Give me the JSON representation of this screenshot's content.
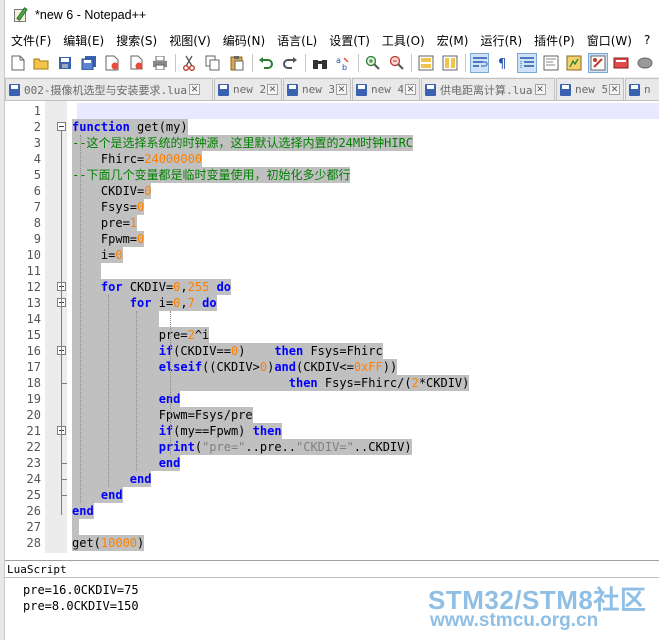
{
  "window": {
    "title": "*new 6 - Notepad++"
  },
  "menu": [
    "文件(F)",
    "编辑(E)",
    "搜索(S)",
    "视图(V)",
    "编码(N)",
    "语言(L)",
    "设置(T)",
    "工具(O)",
    "宏(M)",
    "运行(R)",
    "插件(P)",
    "窗口(W)",
    "?"
  ],
  "toolbar": {
    "buttons": [
      "new-file",
      "open-file",
      "save",
      "save-all",
      "close",
      "close-all",
      "print",
      "cut",
      "copy",
      "paste",
      "undo",
      "redo",
      "find",
      "replace",
      "zoom-in",
      "zoom-out",
      "sync-v",
      "sync-h",
      "word-wrap",
      "show-all-chars",
      "indent-guide",
      "user-define",
      "doc-map",
      "function-list",
      "folder-workspace",
      "record-macro"
    ]
  },
  "tabs": [
    {
      "label": "002-摄像机选型与安装要求.lua",
      "active": false
    },
    {
      "label": "new 2",
      "active": false
    },
    {
      "label": "new 3",
      "active": false
    },
    {
      "label": "new 4",
      "active": false
    },
    {
      "label": "供电距离计算.lua",
      "active": false
    },
    {
      "label": "new 5",
      "active": false
    },
    {
      "label": "n",
      "active": false
    }
  ],
  "editor": {
    "line_numbers": [
      "1",
      "2",
      "3",
      "4",
      "5",
      "6",
      "7",
      "8",
      "9",
      "10",
      "11",
      "12",
      "13",
      "14",
      "15",
      "16",
      "17",
      "18",
      "19",
      "20",
      "21",
      "22",
      "23",
      "24",
      "25",
      "26",
      "27",
      "28"
    ],
    "lines": [
      [],
      [
        {
          "t": "function",
          "c": "kw"
        },
        {
          "t": " get(my)",
          "c": "fn"
        }
      ],
      [
        {
          "t": "--这个是选择系统的时钟源，这里默认选择内置的24M时钟HIRC",
          "c": "cmt"
        }
      ],
      [
        {
          "t": "    Fhirc=",
          "c": "fn"
        },
        {
          "t": "24000000",
          "c": "num"
        }
      ],
      [
        {
          "t": "--下面几个变量都是临时变量使用，初始化多少都行",
          "c": "cmt"
        }
      ],
      [
        {
          "t": "    CKDIV=",
          "c": "fn"
        },
        {
          "t": "0",
          "c": "num"
        }
      ],
      [
        {
          "t": "    Fsys=",
          "c": "fn"
        },
        {
          "t": "0",
          "c": "num"
        }
      ],
      [
        {
          "t": "    pre=",
          "c": "fn"
        },
        {
          "t": "1",
          "c": "num"
        }
      ],
      [
        {
          "t": "    Fpwm=",
          "c": "fn"
        },
        {
          "t": "0",
          "c": "num"
        }
      ],
      [
        {
          "t": "    i=",
          "c": "fn"
        },
        {
          "t": "0",
          "c": "num"
        }
      ],
      [
        {
          "t": "    ",
          "c": "fn"
        }
      ],
      [
        {
          "t": "    ",
          "c": "fn"
        },
        {
          "t": "for",
          "c": "kw"
        },
        {
          "t": " CKDIV=",
          "c": "fn"
        },
        {
          "t": "0",
          "c": "num"
        },
        {
          "t": ",",
          "c": "fn"
        },
        {
          "t": "255",
          "c": "num"
        },
        {
          "t": " ",
          "c": "fn"
        },
        {
          "t": "do",
          "c": "kw"
        }
      ],
      [
        {
          "t": "        ",
          "c": "fn"
        },
        {
          "t": "for",
          "c": "kw"
        },
        {
          "t": " i=",
          "c": "fn"
        },
        {
          "t": "0",
          "c": "num"
        },
        {
          "t": ",",
          "c": "fn"
        },
        {
          "t": "7",
          "c": "num"
        },
        {
          "t": " ",
          "c": "fn"
        },
        {
          "t": "do",
          "c": "kw"
        }
      ],
      [
        {
          "t": "            ",
          "c": "fn"
        }
      ],
      [
        {
          "t": "            pre=",
          "c": "fn"
        },
        {
          "t": "2",
          "c": "num"
        },
        {
          "t": "^i",
          "c": "fn"
        }
      ],
      [
        {
          "t": "            ",
          "c": "fn"
        },
        {
          "t": "if",
          "c": "kw"
        },
        {
          "t": "(CKDIV==",
          "c": "fn"
        },
        {
          "t": "0",
          "c": "num"
        },
        {
          "t": ")    ",
          "c": "fn"
        },
        {
          "t": "then",
          "c": "kw"
        },
        {
          "t": " Fsys=Fhirc",
          "c": "fn"
        }
      ],
      [
        {
          "t": "            ",
          "c": "fn"
        },
        {
          "t": "elseif",
          "c": "kw"
        },
        {
          "t": "((CKDIV>",
          "c": "fn"
        },
        {
          "t": "0",
          "c": "num"
        },
        {
          "t": ")",
          "c": "fn"
        },
        {
          "t": "and",
          "c": "kw"
        },
        {
          "t": "(CKDIV<=",
          "c": "fn"
        },
        {
          "t": "0xFF",
          "c": "num"
        },
        {
          "t": "))",
          "c": "fn"
        }
      ],
      [
        {
          "t": "                              ",
          "c": "fn"
        },
        {
          "t": "then",
          "c": "kw"
        },
        {
          "t": " Fsys=Fhirc/(",
          "c": "fn"
        },
        {
          "t": "2",
          "c": "num"
        },
        {
          "t": "*CKDIV)",
          "c": "fn"
        }
      ],
      [
        {
          "t": "            ",
          "c": "fn"
        },
        {
          "t": "end",
          "c": "kw"
        }
      ],
      [
        {
          "t": "            Fpwm=Fsys/pre",
          "c": "fn"
        }
      ],
      [
        {
          "t": "            ",
          "c": "fn"
        },
        {
          "t": "if",
          "c": "kw"
        },
        {
          "t": "(my==Fpwm) ",
          "c": "fn"
        },
        {
          "t": "then",
          "c": "kw"
        }
      ],
      [
        {
          "t": "            ",
          "c": "fn"
        },
        {
          "t": "print",
          "c": "kw"
        },
        {
          "t": "(",
          "c": "fn"
        },
        {
          "t": "\"pre=\"",
          "c": "str"
        },
        {
          "t": "..pre..",
          "c": "fn"
        },
        {
          "t": "\"CKDIV=\"",
          "c": "str"
        },
        {
          "t": "..CKDIV)",
          "c": "fn"
        }
      ],
      [
        {
          "t": "            ",
          "c": "fn"
        },
        {
          "t": "end",
          "c": "kw"
        }
      ],
      [
        {
          "t": "        ",
          "c": "fn"
        },
        {
          "t": "end",
          "c": "kw"
        }
      ],
      [
        {
          "t": "    ",
          "c": "fn"
        },
        {
          "t": "end",
          "c": "kw"
        }
      ],
      [
        {
          "t": "end",
          "c": "kw"
        }
      ],
      [
        {
          "t": " ",
          "c": "fn"
        }
      ],
      [
        {
          "t": "get(",
          "c": "fn"
        },
        {
          "t": "10000",
          "c": "num"
        },
        {
          "t": ")",
          "c": "fn"
        }
      ]
    ]
  },
  "console": {
    "title": "LuaScript",
    "output": [
      "pre=16.0CKDIV=75",
      "pre=8.0CKDIV=150"
    ]
  },
  "watermark": {
    "line1": "STM32/STM8社区",
    "line2": "www.stmcu.org.cn"
  },
  "colors": {
    "keyword": "#0000ff",
    "number": "#ff8000",
    "comment": "#008000",
    "string": "#808080",
    "selection": "#c0c0c0"
  }
}
